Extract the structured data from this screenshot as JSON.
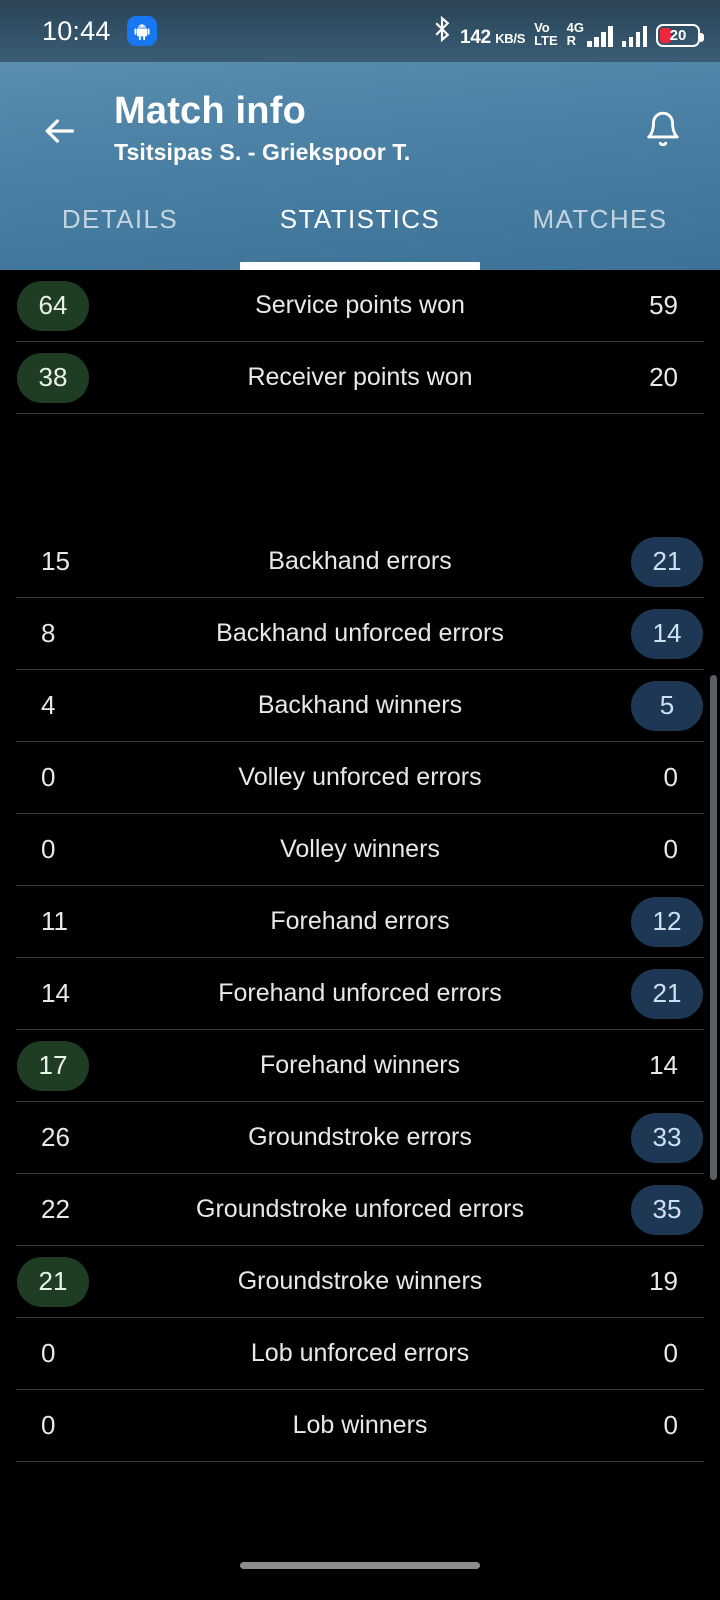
{
  "statusbar": {
    "time": "10:44",
    "app_icon": "android-robot-icon",
    "bluetooth_icon": "bluetooth-icon",
    "net_speed_value": "142",
    "net_speed_unit": "KB/S",
    "volte_line1": "Vo",
    "volte_line2": "LTE",
    "sim_label_top": "4G",
    "sim_label_bottom": "R",
    "battery_percent": "20",
    "battery_color": "#f0263c"
  },
  "appbar": {
    "back_icon": "arrow-left-icon",
    "title": "Match info",
    "subtitle": "Tsitsipas S. - Griekspoor T.",
    "notification_icon": "bell-icon",
    "accent": "#4c82a6",
    "tabs": [
      {
        "label": "DETAILS",
        "active": false
      },
      {
        "label": "STATISTICS",
        "active": true
      },
      {
        "label": "MATCHES",
        "active": false
      }
    ]
  },
  "colors": {
    "background": "#000000",
    "badge_green_bg": "#1f3d23",
    "badge_blue_bg": "#1d3755",
    "divider": "#3a3a3a",
    "text": "#e8e8e8"
  },
  "statistics": {
    "groups": [
      {
        "rows": [
          {
            "label": "Service points won",
            "home": "64",
            "away": "59",
            "home_highlight": "green",
            "away_highlight": "none"
          },
          {
            "label": "Receiver points won",
            "home": "38",
            "away": "20",
            "home_highlight": "green",
            "away_highlight": "none"
          }
        ]
      },
      {
        "rows": [
          {
            "label": "Backhand errors",
            "home": "15",
            "away": "21",
            "home_highlight": "none",
            "away_highlight": "blue"
          },
          {
            "label": "Backhand unforced errors",
            "home": "8",
            "away": "14",
            "home_highlight": "none",
            "away_highlight": "blue"
          },
          {
            "label": "Backhand winners",
            "home": "4",
            "away": "5",
            "home_highlight": "none",
            "away_highlight": "blue"
          },
          {
            "label": "Volley unforced errors",
            "home": "0",
            "away": "0",
            "home_highlight": "none",
            "away_highlight": "none"
          },
          {
            "label": "Volley winners",
            "home": "0",
            "away": "0",
            "home_highlight": "none",
            "away_highlight": "none"
          },
          {
            "label": "Forehand errors",
            "home": "11",
            "away": "12",
            "home_highlight": "none",
            "away_highlight": "blue"
          },
          {
            "label": "Forehand unforced errors",
            "home": "14",
            "away": "21",
            "home_highlight": "none",
            "away_highlight": "blue"
          },
          {
            "label": "Forehand winners",
            "home": "17",
            "away": "14",
            "home_highlight": "green",
            "away_highlight": "none"
          },
          {
            "label": "Groundstroke errors",
            "home": "26",
            "away": "33",
            "home_highlight": "none",
            "away_highlight": "blue"
          },
          {
            "label": "Groundstroke unforced errors",
            "home": "22",
            "away": "35",
            "home_highlight": "none",
            "away_highlight": "blue"
          },
          {
            "label": "Groundstroke winners",
            "home": "21",
            "away": "19",
            "home_highlight": "green",
            "away_highlight": "none"
          },
          {
            "label": "Lob unforced errors",
            "home": "0",
            "away": "0",
            "home_highlight": "none",
            "away_highlight": "none"
          },
          {
            "label": "Lob winners",
            "home": "0",
            "away": "0",
            "home_highlight": "none",
            "away_highlight": "none"
          }
        ]
      }
    ]
  },
  "navbar": {
    "home_indicator": "home-pill-indicator"
  }
}
